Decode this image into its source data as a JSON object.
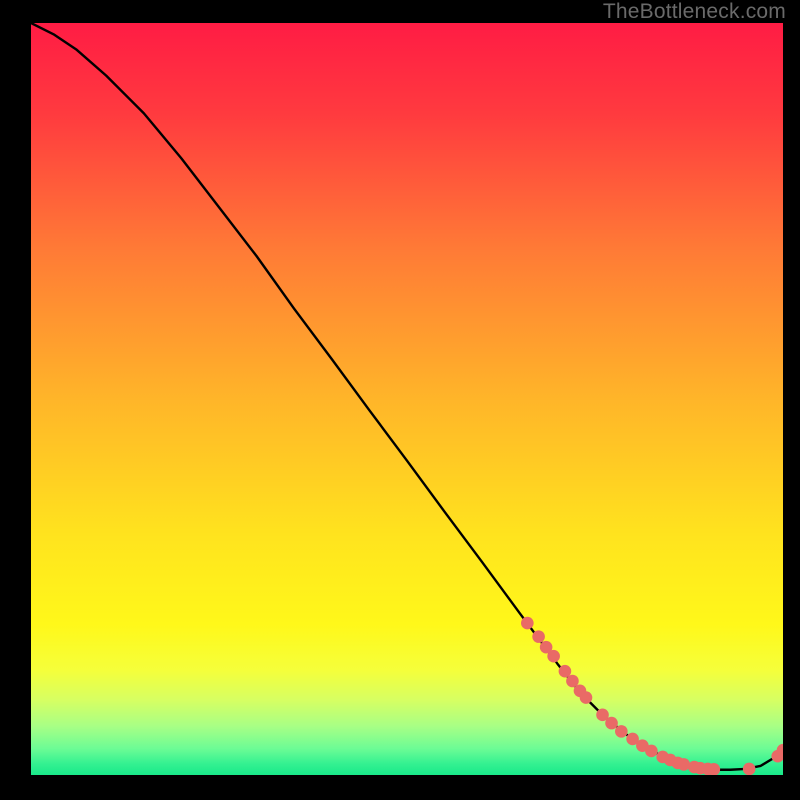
{
  "watermark": "TheBottleneck.com",
  "colors": {
    "bg": "#000000",
    "gradient_top": "#ff1c44",
    "gradient_mid": "#ffd400",
    "gradient_green_light": "#b7ff8a",
    "gradient_green": "#26f08e",
    "curve": "#000000",
    "marker": "#e96a66",
    "watermark": "#6a6a6a"
  },
  "chart_data": {
    "type": "line",
    "title": "",
    "xlabel": "",
    "ylabel": "",
    "xlim": [
      0,
      100
    ],
    "ylim": [
      0,
      100
    ],
    "series": [
      {
        "name": "bottleneck-curve",
        "x": [
          0,
          3,
          6,
          10,
          15,
          20,
          25,
          30,
          35,
          40,
          45,
          50,
          55,
          60,
          65,
          70,
          73,
          76,
          79,
          82,
          85,
          87,
          89,
          91,
          93,
          95,
          97,
          99,
          100
        ],
        "y": [
          100,
          98.5,
          96.5,
          93,
          88,
          82,
          75.5,
          69,
          62,
          55.3,
          48.5,
          41.8,
          35,
          28.3,
          21.5,
          14.8,
          11,
          8,
          5.5,
          3.5,
          2,
          1.3,
          0.9,
          0.7,
          0.7,
          0.8,
          1.2,
          2.4,
          3.3
        ]
      }
    ],
    "markers": {
      "name": "highlighted-points",
      "x": [
        66,
        67.5,
        68.5,
        69.5,
        71,
        72,
        73,
        73.8,
        76,
        77.2,
        78.5,
        80,
        81.3,
        82.5,
        84,
        85,
        86,
        86.8,
        88.2,
        89,
        90,
        90.8,
        95.5,
        99.3,
        100
      ],
      "y": [
        20.2,
        18.4,
        17,
        15.8,
        13.8,
        12.5,
        11.2,
        10.3,
        8,
        6.9,
        5.8,
        4.8,
        3.9,
        3.2,
        2.4,
        2,
        1.6,
        1.4,
        1.05,
        0.9,
        0.8,
        0.75,
        0.8,
        2.5,
        3.3
      ]
    }
  }
}
